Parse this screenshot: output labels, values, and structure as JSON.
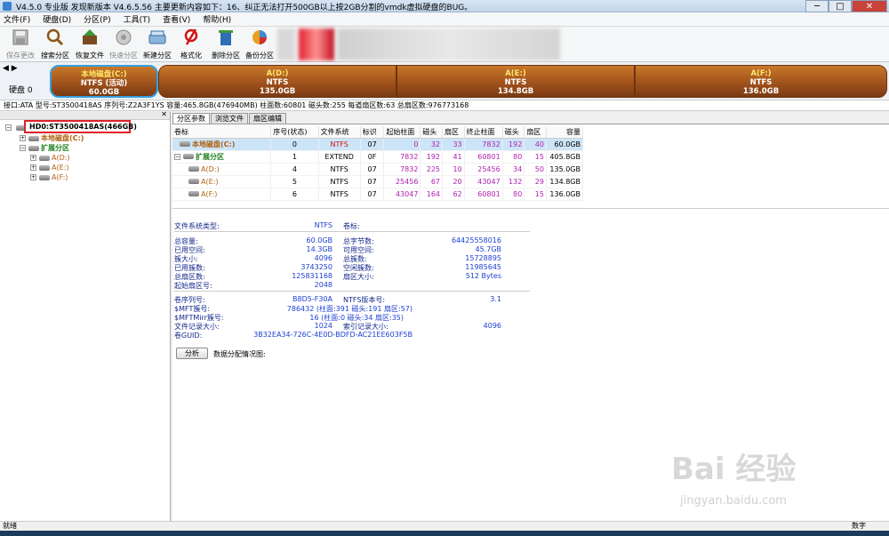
{
  "window": {
    "title": "V4.5.0 专业版   发现新版本 V4.6.5.56 主要更新内容如下：16、纠正无法打开500GB以上按2GB分割的vmdk虚拟硬盘的BUG。",
    "btn_min": "─",
    "btn_max": "□",
    "btn_close": "✕"
  },
  "menu": [
    "文件(F)",
    "硬盘(D)",
    "分区(P)",
    "工具(T)",
    "查看(V)",
    "帮助(H)"
  ],
  "toolbar": [
    {
      "label": "保存更改",
      "icon": "save-icon",
      "enabled": false
    },
    {
      "label": "搜索分区",
      "icon": "search-icon",
      "enabled": true
    },
    {
      "label": "恢复文件",
      "icon": "recover-icon",
      "enabled": true
    },
    {
      "label": "快速分区",
      "icon": "quick-partition-icon",
      "enabled": false
    },
    {
      "label": "新建分区",
      "icon": "new-partition-icon",
      "enabled": true
    },
    {
      "label": "格式化",
      "icon": "format-icon",
      "enabled": true
    },
    {
      "label": "删除分区",
      "icon": "delete-icon",
      "enabled": true
    },
    {
      "label": "备份分区",
      "icon": "backup-icon",
      "enabled": true
    }
  ],
  "disk": {
    "label": "硬盘 0",
    "partitions": [
      {
        "name": "本地磁盘(C:)",
        "fs": "NTFS (活动)",
        "size": "60.0GB",
        "selected": true
      },
      {
        "name": "A(D:)",
        "fs": "NTFS",
        "size": "135.0GB"
      },
      {
        "name": "A(E:)",
        "fs": "NTFS",
        "size": "134.8GB"
      },
      {
        "name": "A(F:)",
        "fs": "NTFS",
        "size": "136.0GB"
      }
    ],
    "info": "接口:ATA  型号:ST3500418AS  序列号:Z2A3F1YS  容量:465.8GB(476940MB)  柱面数:60801  磁头数:255  每道扇区数:63  总扇区数:976773168"
  },
  "tree": {
    "hdd": "HD0:ST3500418AS(466GB)",
    "primary": "本地磁盘(C:)",
    "extended": "扩展分区",
    "logical": [
      "A(D:)",
      "A(E:)",
      "A(F:)"
    ]
  },
  "tabs": [
    "分区参数",
    "浏览文件",
    "扇区编辑"
  ],
  "table": {
    "headers": [
      "卷标",
      "序号(状态)",
      "文件系统",
      "标识",
      "起始柱面",
      "磁头",
      "扇区",
      "终止柱面",
      "磁头",
      "扇区",
      "容量"
    ],
    "rows": [
      {
        "name": "本地磁盘(C:)",
        "idx": "0",
        "fs": "NTFS",
        "id": "07",
        "sc": "0",
        "sh": "32",
        "ss": "33",
        "ec": "7832",
        "eh": "192",
        "es": "40",
        "cap": "60.0GB"
      },
      {
        "name": "扩展分区",
        "idx": "1",
        "fs": "EXTEND",
        "id": "0F",
        "sc": "7832",
        "sh": "192",
        "ss": "41",
        "ec": "60801",
        "eh": "80",
        "es": "15",
        "cap": "405.8GB"
      },
      {
        "name": "A(D:)",
        "idx": "4",
        "fs": "NTFS",
        "id": "07",
        "sc": "7832",
        "sh": "225",
        "ss": "10",
        "ec": "25456",
        "eh": "34",
        "es": "50",
        "cap": "135.0GB"
      },
      {
        "name": "A(E:)",
        "idx": "5",
        "fs": "NTFS",
        "id": "07",
        "sc": "25456",
        "sh": "67",
        "ss": "20",
        "ec": "43047",
        "eh": "132",
        "es": "29",
        "cap": "134.8GB"
      },
      {
        "name": "A(F:)",
        "idx": "6",
        "fs": "NTFS",
        "id": "07",
        "sc": "43047",
        "sh": "164",
        "ss": "62",
        "ec": "60801",
        "eh": "80",
        "es": "15",
        "cap": "136.0GB"
      }
    ]
  },
  "fsinfo": {
    "type_label": "文件系统类型:",
    "type_value": "NTFS",
    "vol_label": "卷标:",
    "total_label": "总容量:",
    "total_value": "60.0GB",
    "free_label": "已用空间:",
    "free_value": "14.3GB",
    "cluster_label": "簇大小:",
    "cluster_value": "4096",
    "used_clusters_label": "已用簇数:",
    "used_clusters_value": "3743250",
    "total_sectors_label": "总扇区数:",
    "total_sectors_value": "125831168",
    "start_sector_label": "起始扇区号:",
    "start_sector_value": "2048",
    "total_bytes_label": "总字节数:",
    "total_bytes_value": "64425558016",
    "avail_label": "可用空间:",
    "avail_value": "45.7GB",
    "total_clusters_label": "总簇数:",
    "total_clusters_value": "15728895",
    "free_clusters_label": "空闲簇数:",
    "free_clusters_value": "11985645",
    "sector_size_label": "扇区大小:",
    "sector_size_value": "512 Bytes",
    "serial_label": "卷序列号:",
    "serial_value": "B8D5-F30A",
    "ntfs_ver_label": "NTFS版本号:",
    "ntfs_ver_value": "3.1",
    "mft_label": "$MFT簇号:",
    "mft_value": "786432 (柱面:391 磁头:191 扇区:57)",
    "mftmirr_label": "$MFTMirr簇号:",
    "mftmirr_value": "16 (柱面:0 磁头:34 扇区:35)",
    "frs_label": "文件记录大小:",
    "frs_value": "1024",
    "irs_label": "索引记录大小:",
    "irs_value": "4096",
    "guid_label": "卷GUID:",
    "guid_value": "3B32EA34-726C-4E0D-BDFD-AC21EE603F5B"
  },
  "analyze": {
    "button": "分析",
    "label": "数据分配情况图:"
  },
  "status": {
    "left": "就绪",
    "right": "数字"
  },
  "watermark": {
    "logo": "Bai 经验",
    "url": "jingyan.baidu.com"
  }
}
